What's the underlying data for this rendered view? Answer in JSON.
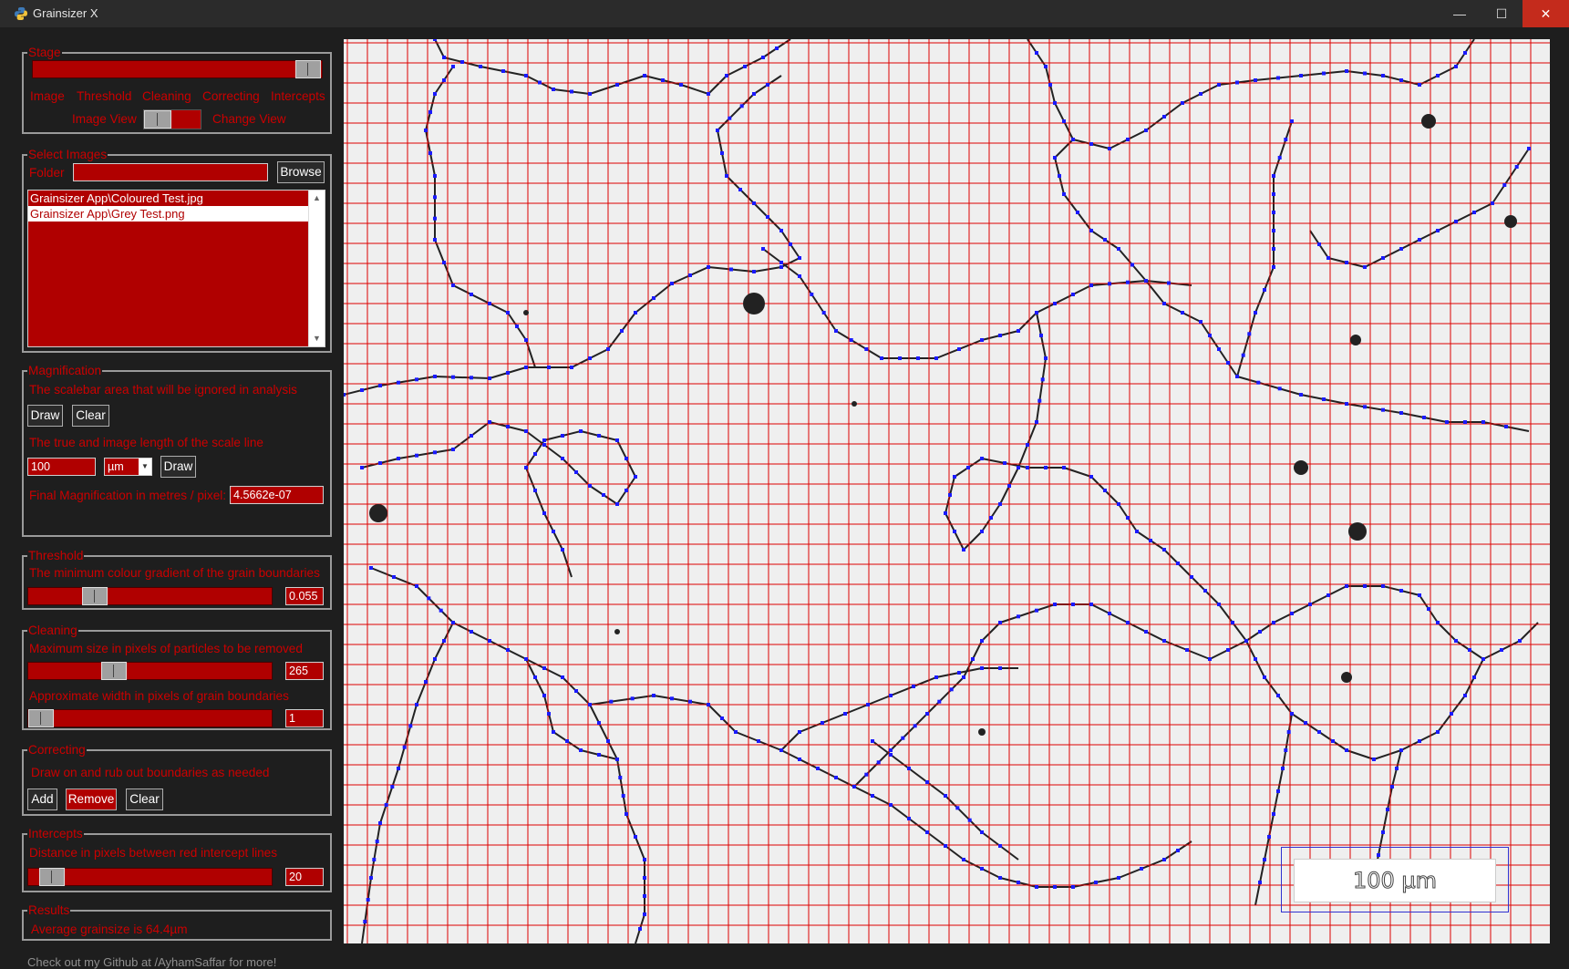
{
  "window": {
    "title": "Grainsizer X",
    "minimize": "—",
    "maximize": "☐",
    "close": "✕"
  },
  "stage": {
    "legend": "Stage",
    "tabs": [
      "Image",
      "Threshold",
      "Cleaning",
      "Correcting",
      "Intercepts"
    ],
    "image_view_label": "Image View",
    "change_view_label": "Change View"
  },
  "select_images": {
    "legend": "Select Images",
    "folder_label": "Folder",
    "folder_value": "",
    "browse_label": "Browse",
    "files": [
      "Grainsizer App\\Coloured Test.jpg",
      "Grainsizer App\\Grey Test.png"
    ]
  },
  "magnification": {
    "legend": "Magnification",
    "scalebar_desc": "The scalebar area that will be ignored in analysis",
    "draw_label": "Draw",
    "clear_label": "Clear",
    "scale_line_desc": "The true and image length of the scale line",
    "length_value": "100",
    "unit_value": "µm",
    "draw2_label": "Draw",
    "final_label": "Final Magnification in metres / pixel:",
    "final_value": "4.5662e-07"
  },
  "threshold": {
    "legend": "Threshold",
    "desc": "The minimum colour gradient of the grain boundaries",
    "value": "0.055",
    "slider_fraction": 0.055
  },
  "cleaning": {
    "legend": "Cleaning",
    "max_size_desc": "Maximum size in pixels of particles to be removed",
    "max_size_value": "265",
    "width_desc": "Approximate width in pixels of grain boundaries",
    "width_value": "1"
  },
  "correcting": {
    "legend": "Correcting",
    "desc": "Draw on and rub out boundaries as needed",
    "add_label": "Add",
    "remove_label": "Remove",
    "clear_label": "Clear"
  },
  "intercepts": {
    "legend": "Intercepts",
    "desc": "Distance in pixels between red intercept lines",
    "value": "20"
  },
  "results": {
    "legend": "Results",
    "text": "Average grainsize is 64.4µm"
  },
  "footer": "Check out my Github at /AyhamSaffar for more!",
  "image": {
    "scalebar_text": "100 µm",
    "grid_color": "#dd0000",
    "boundary_color": "#222222",
    "intercept_color": "#1a1aff"
  }
}
